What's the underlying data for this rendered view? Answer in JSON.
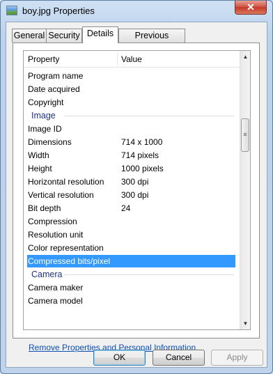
{
  "window": {
    "title": "boy.jpg Properties",
    "close_label": "✕"
  },
  "tabs": [
    {
      "label": "General"
    },
    {
      "label": "Security"
    },
    {
      "label": "Details"
    },
    {
      "label": "Previous Versions"
    }
  ],
  "active_tab": "Details",
  "list": {
    "col_property": "Property",
    "col_value": "Value",
    "rows": [
      {
        "name": "Program name",
        "value": ""
      },
      {
        "name": "Date acquired",
        "value": ""
      },
      {
        "name": "Copyright",
        "value": ""
      },
      {
        "group": "Image"
      },
      {
        "name": "Image ID",
        "value": ""
      },
      {
        "name": "Dimensions",
        "value": "714 x 1000"
      },
      {
        "name": "Width",
        "value": "714 pixels"
      },
      {
        "name": "Height",
        "value": "1000 pixels"
      },
      {
        "name": "Horizontal resolution",
        "value": "300 dpi"
      },
      {
        "name": "Vertical resolution",
        "value": "300 dpi"
      },
      {
        "name": "Bit depth",
        "value": "24"
      },
      {
        "name": "Compression",
        "value": ""
      },
      {
        "name": "Resolution unit",
        "value": ""
      },
      {
        "name": "Color representation",
        "value": ""
      },
      {
        "name": "Compressed bits/pixel",
        "value": "",
        "selected": true
      },
      {
        "group": "Camera"
      },
      {
        "name": "Camera maker",
        "value": ""
      },
      {
        "name": "Camera model",
        "value": ""
      }
    ]
  },
  "remove_link": "Remove Properties and Personal Information",
  "buttons": {
    "ok": "OK",
    "cancel": "Cancel",
    "apply": "Apply"
  }
}
